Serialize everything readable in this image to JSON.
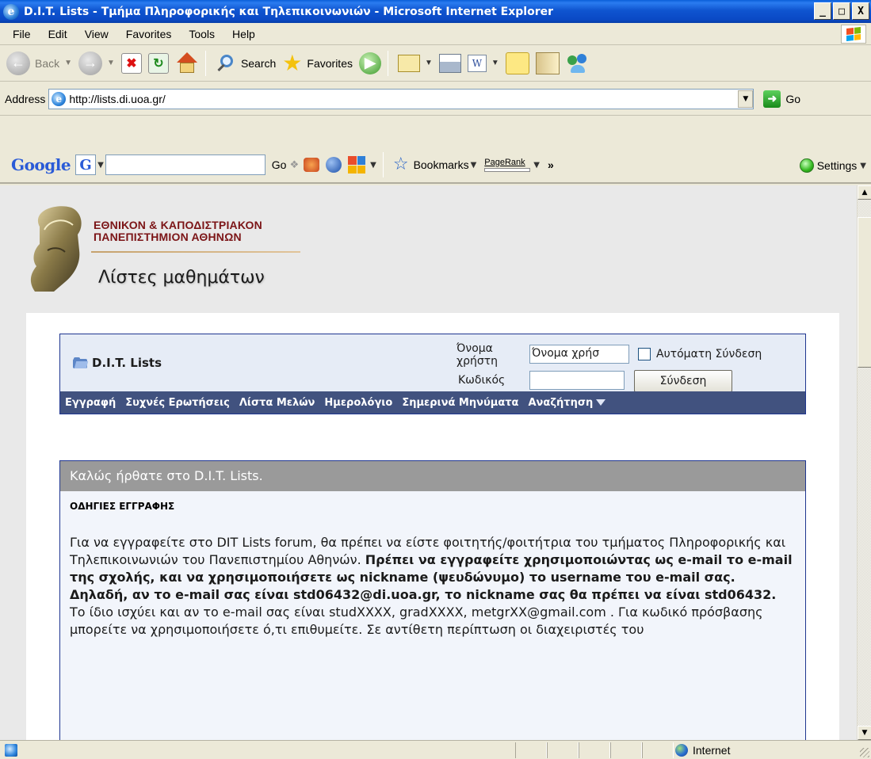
{
  "window": {
    "title": "D.I.T. Lists - Τμήμα Πληροφορικής και Τηλεπικοινωνιών - Microsoft Internet Explorer",
    "icon": "ie-icon",
    "buttons": [
      "_",
      "□",
      "X"
    ]
  },
  "menu": {
    "items": [
      "File",
      "Edit",
      "View",
      "Favorites",
      "Tools",
      "Help"
    ]
  },
  "toolbar": {
    "back_label": "Back",
    "search_label": "Search",
    "favorites_label": "Favorites"
  },
  "address": {
    "label": "Address",
    "url": "http://lists.di.uoa.gr/",
    "go_label": "Go"
  },
  "google_toolbar": {
    "logo": "Google",
    "go_label": "Go",
    "bookmarks_label": "Bookmarks",
    "pagerank_label": "PageRank",
    "more_label": "»",
    "settings_label": "Settings"
  },
  "header": {
    "university_line1": "ΕΘΝΙΚΟΝ & ΚΑΠΟΔΙΣΤΡΙΑΚΟΝ",
    "university_line2": "ΠΑΝΕΠΙΣΤΗΜΙΟΝ ΑΘΗΝΩΝ",
    "tagline": "Λίστες μαθημάτων"
  },
  "forum": {
    "title": "D.I.T. Lists",
    "login": {
      "username_label": "Όνομα χρήστη",
      "username_value": "Όνομα χρήσ",
      "autologin_label": "Αυτόματη Σύνδεση",
      "password_label": "Κωδικός",
      "submit_label": "Σύνδεση"
    },
    "nav": [
      "Εγγραφή",
      "Συχνές Ερωτήσεις",
      "Λίστα Μελών",
      "Ημερολόγιο",
      "Σημερινά Μηνύματα",
      "Αναζήτηση"
    ]
  },
  "welcome": {
    "title": "Καλώς ήρθατε στο D.I.T. Lists.",
    "heading": "ΟΔΗΓΙΕΣ ΕΓΓΡΑΦΗΣ",
    "p1": "Για να εγγραφείτε στο DIT Lists forum, θα πρέπει να είστε φοιτητής/φοιτήτρια του τμήματος Πληροφορικής και Τηλεπικοινωνιών του Πανεπιστημίου Αθηνών.",
    "p_bold": "Πρέπει να εγγραφείτε χρησιμοποιώντας ως e-mail το e-mail της σχολής, και να χρησιμοποιήσετε ως nickname (ψευδώνυμο) το username του e-mail σας. Δηλαδή, αν το e-mail σας είναι std06432@di.uoa.gr, το nickname σας θα πρέπει να είναι std06432.",
    "p2": " Το ίδιο ισχύει και αν το e-mail σας είναι studXXXX, gradXXXX, metgrXX@gmail.com . Για κωδικό πρόσβασης μπορείτε να χρησιμοποιήσετε ό,τι επιθυμείτε. Σε αντίθετη περίπτωση οι διαχειριστές του"
  },
  "status": {
    "zone": "Internet"
  },
  "colors": {
    "titlebar": "#0a49c5",
    "navbar": "#41527f",
    "border": "#1f3690",
    "welcome_bar": "#9a9a9a"
  }
}
